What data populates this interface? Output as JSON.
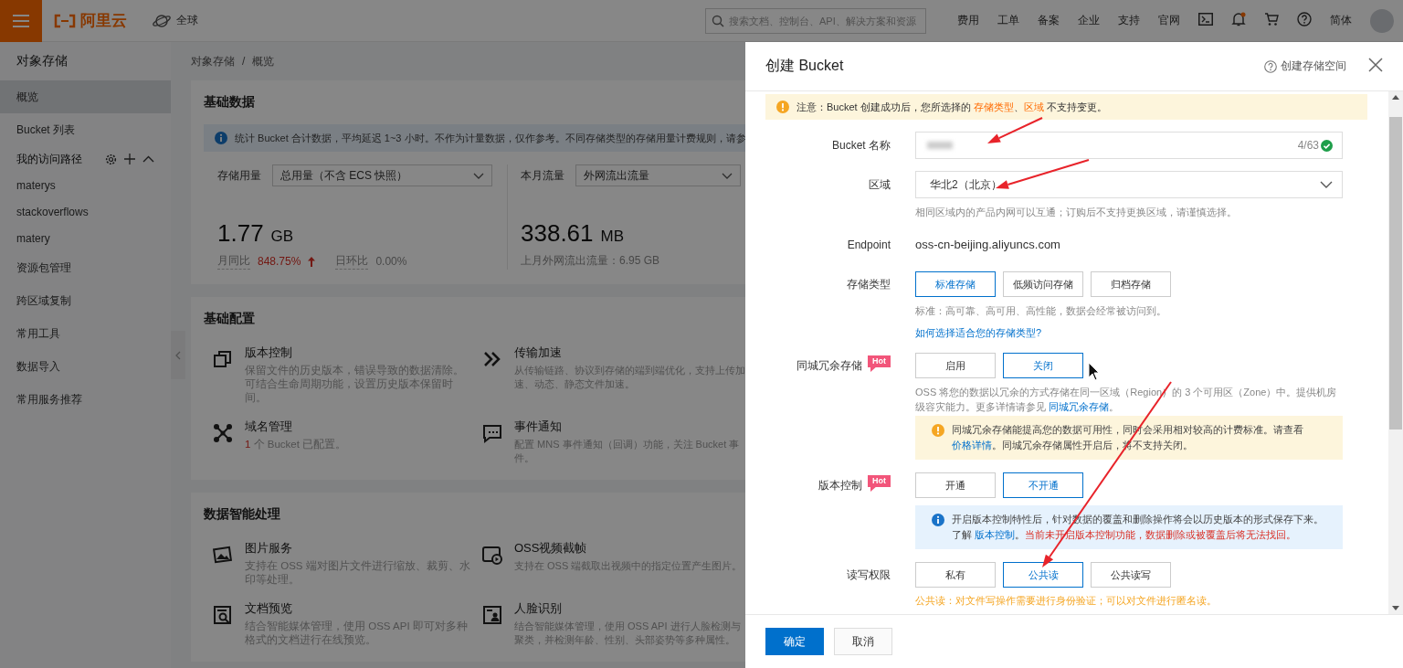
{
  "top_bar": {
    "logo": "阿里云",
    "region": "全球",
    "search": {
      "placeholder": "搜索文档、控制台、API、解决方案和资源"
    },
    "links": [
      "费用",
      "工单",
      "备案",
      "企业",
      "支持",
      "官网"
    ],
    "language": "简体"
  },
  "sidebar": {
    "title": "对象存储",
    "items": [
      {
        "label": "概览",
        "selected": true
      },
      {
        "label": "Bucket 列表",
        "selected": false
      },
      {
        "label": "我的访问路径",
        "selected": false,
        "kind": "group",
        "expanded": true,
        "children": [
          {
            "label": "materys",
            "selected": false
          },
          {
            "label": "stackoverflows",
            "selected": false
          },
          {
            "label": "matery",
            "selected": false
          }
        ]
      },
      {
        "label": "资源包管理",
        "selected": false
      },
      {
        "label": "跨区域复制",
        "selected": false
      },
      {
        "label": "常用工具",
        "selected": false
      },
      {
        "label": "数据导入",
        "selected": false
      },
      {
        "label": "常用服务推荐",
        "selected": false
      }
    ]
  },
  "breadcrumb": {
    "items": [
      "对象存储",
      "概览"
    ],
    "separator": "/"
  },
  "cards": [
    {
      "kind": "stats",
      "title": "基础数据",
      "notice": "统计 Bucket 合计数据，平均延迟 1~3 小时。不作为计量数据，仅作参考。不同存储类型的存储用量计费规则，请参",
      "metrics": [
        {
          "label": "存储用量",
          "select": "总用量（不含 ECS 快照）",
          "value": "1.77",
          "unit": "GB",
          "stats": [
            {
              "label": "月同比",
              "value": "848.75%",
              "increase": true
            },
            {
              "label": "日环比",
              "value": "0.00%",
              "increase": false
            }
          ]
        },
        {
          "label": "本月流量",
          "select": "外网流出流量",
          "value": "338.61",
          "unit": "MB",
          "footnote": "上月外网流出流量：6.95 GB"
        }
      ]
    },
    {
      "kind": "features",
      "title": "基础配置",
      "features": [
        {
          "title": "版本控制",
          "description": "保留文件的历史版本，错误导致的数据清除。可结合生命周期功能，设置历史版本保留时间。"
        },
        {
          "title": "传输加速",
          "description": "从传输链路、协议到存储的端到端优化，支持上传加速、动态、静态文件加速。"
        },
        {
          "title": "域名管理",
          "count": "1",
          "description": "个 Bucket 已配置。"
        },
        {
          "title": "事件通知",
          "description": "配置 MNS 事件通知（回调）功能，关注 Bucket 事件。"
        }
      ]
    },
    {
      "kind": "features",
      "title": "数据智能处理",
      "features": [
        {
          "title": "图片服务",
          "description": "支持在 OSS 端对图片文件进行缩放、裁剪、水印等处理。"
        },
        {
          "title": "OSS视频截帧",
          "description": "支持在 OSS 端截取出视频中的指定位置产生图片。"
        },
        {
          "title": "文档预览",
          "description": "结合智能媒体管理，使用 OSS API 即可对多种格式的文档进行在线预览。"
        },
        {
          "title": "人脸识别",
          "description": "结合智能媒体管理，使用 OSS API 进行人脸检测与聚类，并检测年龄、性别、头部姿势等多种属性。"
        }
      ]
    }
  ],
  "drawer": {
    "title": "创建 Bucket",
    "help_link": "创建存储空间",
    "notice": [
      "注意：Bucket 创建成功后，您所选择的 ",
      {
        "kind": "highlight",
        "text": "存储类型"
      },
      "、",
      {
        "kind": "highlight",
        "text": "区域"
      },
      " 不支持变更。"
    ],
    "fields": [
      {
        "kind": "input",
        "label": "Bucket 名称",
        "counter": "4/63"
      },
      {
        "kind": "select",
        "label": "区域",
        "value": "华北2（北京）",
        "notes": [
          {
            "kind": "help",
            "lines": [
              [
                "相同区域内的产品内网可以互通；订购后不支持更换区域，请谨慎选择。"
              ]
            ]
          }
        ]
      },
      {
        "kind": "text",
        "label": "Endpoint",
        "value": "oss-cn-beijing.aliyuncs.com"
      },
      {
        "kind": "options",
        "label": "存储类型",
        "options": [
          {
            "label": "标准存储",
            "selected": true
          },
          {
            "label": "低频访问存储",
            "selected": false
          },
          {
            "label": "归档存储",
            "selected": false
          }
        ],
        "notes": [
          {
            "kind": "help",
            "lines": [
              [
                "标准：高可靠、高可用、高性能，数据会经常被访问到。"
              ]
            ]
          },
          {
            "kind": "link",
            "lines": [
              [
                "如何选择适合您的存储类型?"
              ]
            ]
          }
        ]
      },
      {
        "kind": "options",
        "label": "同城冗余存储",
        "badge": "Hot",
        "options": [
          {
            "label": "启用",
            "selected": false
          },
          {
            "label": "关闭",
            "selected": true
          }
        ],
        "notes": [
          {
            "kind": "help",
            "lines": [
              [
                "OSS 将您的数据以冗余的方式存储在同一区域（Region）的 3 个可用区（Zone）中。提供机房级容灾能力。更多详情请参见 ",
                {
                  "kind": "link",
                  "text": "同城冗余存储"
                },
                "。"
              ]
            ]
          },
          {
            "kind": "warning",
            "lines": [
              [
                "同城冗余存储能提高您的数据可用性，同时会采用相对较高的计费标准。请查看"
              ],
              [
                {
                  "kind": "link",
                  "text": "价格详情"
                },
                "。同城冗余存储属性开启后，将不支持关闭。"
              ]
            ]
          }
        ]
      },
      {
        "kind": "options",
        "label": "版本控制",
        "badge": "Hot",
        "options": [
          {
            "label": "开通",
            "selected": false
          },
          {
            "label": "不开通",
            "selected": true
          }
        ],
        "notes": [
          {
            "kind": "info",
            "lines": [
              [
                "开启版本控制特性后，针对数据的覆盖和删除操作将会以历史版本的形式保存下来。"
              ],
              [
                "了解 ",
                {
                  "kind": "link",
                  "text": "版本控制"
                },
                "。",
                {
                  "kind": "danger",
                  "text": "当前未开启版本控制功能，数据删除或被覆盖后将无法找回。"
                }
              ]
            ]
          }
        ]
      },
      {
        "kind": "options",
        "label": "读写权限",
        "options": [
          {
            "label": "私有",
            "selected": false
          },
          {
            "label": "公共读",
            "selected": true
          },
          {
            "label": "公共读写",
            "selected": false
          }
        ],
        "notes": [
          {
            "kind": "caution",
            "lines": [
              [
                "公共读：对文件写操作需要进行身份验证；可以对文件进行匿名读。"
              ]
            ]
          }
        ]
      }
    ],
    "buttons": [
      {
        "label": "确定",
        "kind": "primary"
      },
      {
        "label": "取消",
        "kind": "default"
      }
    ]
  }
}
